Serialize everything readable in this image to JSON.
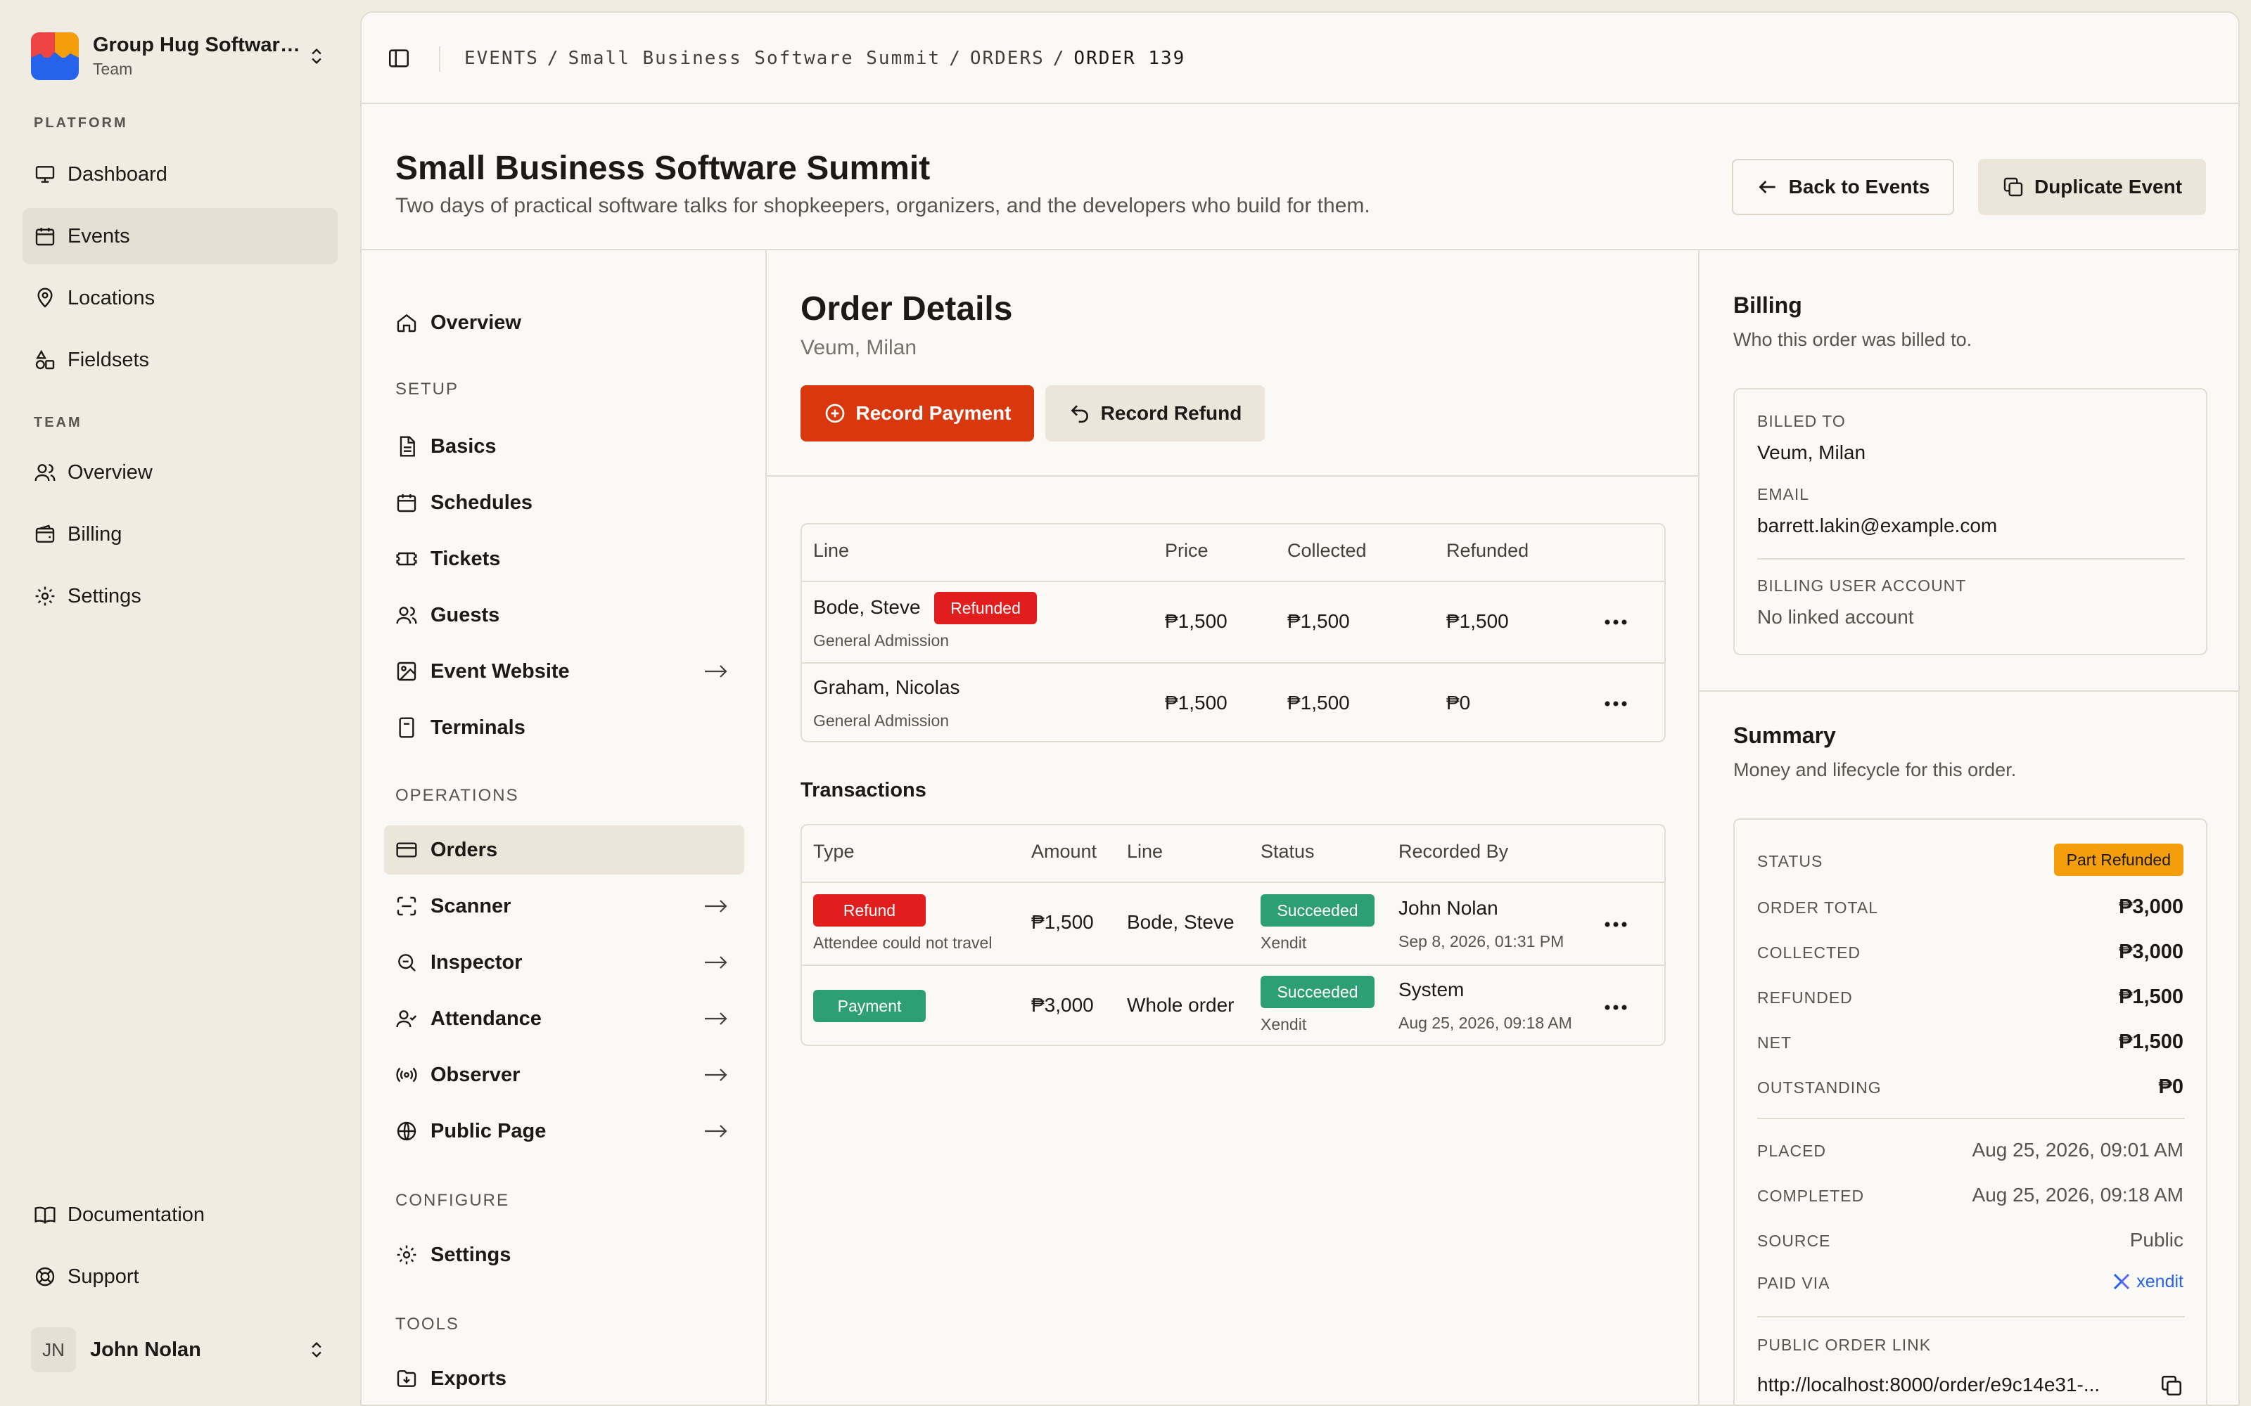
{
  "team": {
    "name": "Group Hug Software...",
    "subtitle": "Team"
  },
  "app_nav": {
    "platform_heading": "PLATFORM",
    "platform_items": [
      {
        "label": "Dashboard",
        "icon": "monitor-icon"
      },
      {
        "label": "Events",
        "icon": "calendar-icon",
        "active": true
      },
      {
        "label": "Locations",
        "icon": "map-pin-icon"
      },
      {
        "label": "Fieldsets",
        "icon": "shapes-icon"
      }
    ],
    "team_heading": "TEAM",
    "team_items": [
      {
        "label": "Overview",
        "icon": "users-icon"
      },
      {
        "label": "Billing",
        "icon": "wallet-icon"
      },
      {
        "label": "Settings",
        "icon": "gear-icon"
      }
    ],
    "footer_items": [
      {
        "label": "Documentation",
        "icon": "book-icon"
      },
      {
        "label": "Support",
        "icon": "lifebuoy-icon"
      }
    ]
  },
  "user": {
    "initials": "JN",
    "name": "John Nolan"
  },
  "breadcrumb": {
    "events": "EVENTS",
    "event": "Small Business Software Summit",
    "orders": "ORDERS",
    "current": "ORDER 139",
    "sep": "/"
  },
  "header": {
    "title": "Small Business Software Summit",
    "description": "Two days of practical software talks for shopkeepers, organizers, and the developers who build for them.",
    "back_label": "Back to Events",
    "duplicate_label": "Duplicate Event"
  },
  "event_nav": {
    "overview": "Overview",
    "setup_heading": "SETUP",
    "setup": [
      "Basics",
      "Schedules",
      "Tickets",
      "Guests",
      "Event Website",
      "Terminals"
    ],
    "operations_heading": "OPERATIONS",
    "operations": [
      "Orders",
      "Scanner",
      "Inspector",
      "Attendance",
      "Observer",
      "Public Page"
    ],
    "configure_heading": "CONFIGURE",
    "configure": [
      "Settings"
    ],
    "tools_heading": "TOOLS",
    "tools": [
      "Exports"
    ]
  },
  "order": {
    "title": "Order Details",
    "customer": "Veum, Milan",
    "record_payment": "Record Payment",
    "record_refund": "Record Refund",
    "lines_headers": {
      "line": "Line",
      "price": "Price",
      "collected": "Collected",
      "refunded": "Refunded"
    },
    "lines": [
      {
        "name": "Bode, Steve",
        "badge": "Refunded",
        "ticket": "General Admission",
        "price": "₱1,500",
        "collected": "₱1,500",
        "refunded": "₱1,500"
      },
      {
        "name": "Graham, Nicolas",
        "ticket": "General Admission",
        "price": "₱1,500",
        "collected": "₱1,500",
        "refunded": "₱0"
      }
    ],
    "transactions_heading": "Transactions",
    "tx_headers": {
      "type": "Type",
      "amount": "Amount",
      "line": "Line",
      "status": "Status",
      "recorded_by": "Recorded By"
    },
    "transactions": [
      {
        "type": "Refund",
        "note": "Attendee could not travel",
        "amount": "₱1,500",
        "line": "Bode, Steve",
        "status": "Succeeded",
        "gateway": "Xendit",
        "by": "John Nolan",
        "when": "Sep 8, 2026, 01:31 PM"
      },
      {
        "type": "Payment",
        "amount": "₱3,000",
        "line": "Whole order",
        "status": "Succeeded",
        "gateway": "Xendit",
        "by": "System",
        "when": "Aug 25, 2026, 09:18 AM"
      }
    ]
  },
  "billing": {
    "title": "Billing",
    "description": "Who this order was billed to.",
    "billed_to_label": "BILLED TO",
    "billed_to": "Veum, Milan",
    "email_label": "EMAIL",
    "email": "barrett.lakin@example.com",
    "account_label": "BILLING USER ACCOUNT",
    "account": "No linked account"
  },
  "summary": {
    "title": "Summary",
    "description": "Money and lifecycle for this order.",
    "status_label": "STATUS",
    "status": "Part Refunded",
    "order_total_label": "ORDER TOTAL",
    "order_total": "₱3,000",
    "collected_label": "COLLECTED",
    "collected": "₱3,000",
    "refunded_label": "REFUNDED",
    "refunded": "₱1,500",
    "net_label": "NET",
    "net": "₱1,500",
    "outstanding_label": "OUTSTANDING",
    "outstanding": "₱0",
    "placed_label": "PLACED",
    "placed": "Aug 25, 2026, 09:01 AM",
    "completed_label": "COMPLETED",
    "completed": "Aug 25, 2026, 09:18 AM",
    "source_label": "SOURCE",
    "source": "Public",
    "paid_via_label": "PAID VIA",
    "paid_via": "xendit",
    "public_link_label": "PUBLIC ORDER LINK",
    "public_link": "http://localhost:8000/order/e9c14e31-..."
  },
  "colors": {
    "accent": "#d9380e",
    "success": "#2e9f74",
    "danger": "#e11d1d",
    "warning": "#f59e0b"
  }
}
